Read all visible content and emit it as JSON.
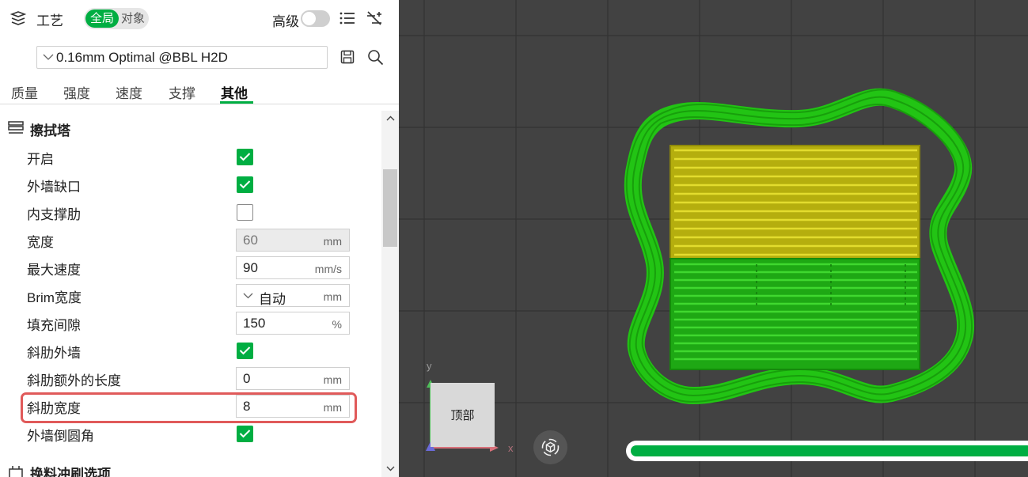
{
  "header": {
    "title": "工艺",
    "scope_global": "全局",
    "scope_object": "对象",
    "advanced_label": "高级",
    "advanced_enabled": false
  },
  "preset": {
    "value": "0.16mm Optimal @BBL H2D"
  },
  "tabs": [
    {
      "label": "质量",
      "active": false
    },
    {
      "label": "强度",
      "active": false
    },
    {
      "label": "速度",
      "active": false
    },
    {
      "label": "支撑",
      "active": false
    },
    {
      "label": "其他",
      "active": true
    }
  ],
  "section": {
    "title": "擦拭塔",
    "rows": [
      {
        "label": "开启",
        "type": "checkbox",
        "checked": true
      },
      {
        "label": "外墙缺口",
        "type": "checkbox",
        "checked": true
      },
      {
        "label": "内支撑肋",
        "type": "checkbox",
        "checked": false
      },
      {
        "label": "宽度",
        "type": "field",
        "value": "60",
        "unit": "mm",
        "disabled": true
      },
      {
        "label": "最大速度",
        "type": "field",
        "value": "90",
        "unit": "mm/s"
      },
      {
        "label": "Brim宽度",
        "type": "select",
        "value": "自动",
        "unit": "mm"
      },
      {
        "label": "填充间隙",
        "type": "field",
        "value": "150",
        "unit": "%"
      },
      {
        "label": "斜肋外墙",
        "type": "checkbox",
        "checked": true
      },
      {
        "label": "斜肋额外的长度",
        "type": "field",
        "value": "0",
        "unit": "mm"
      },
      {
        "label": "斜肋宽度",
        "type": "field",
        "value": "8",
        "unit": "mm",
        "highlighted": true
      },
      {
        "label": "外墙倒圆角",
        "type": "checkbox",
        "checked": true
      }
    ]
  },
  "section2": {
    "title": "换料冲刷选项"
  },
  "viewport": {
    "view_cube_label": "顶部",
    "axis_x": "x",
    "axis_y": "y",
    "progress": 1.0
  },
  "colors": {
    "accent": "#00ae42",
    "highlight": "#e05a5a",
    "brim_green": "#22c414",
    "tower_yellow": "#c9c212",
    "viewport_bg": "#424242"
  }
}
